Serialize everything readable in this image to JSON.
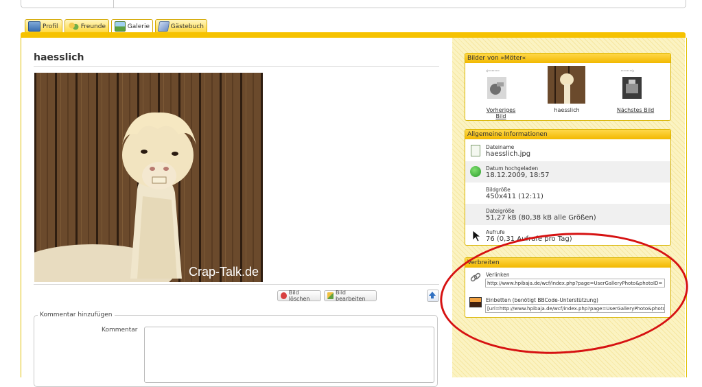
{
  "tabs": [
    {
      "label": "Profil",
      "icon": "profile-card-icon"
    },
    {
      "label": "Freunde",
      "icon": "friends-icon"
    },
    {
      "label": "Galerie",
      "icon": "gallery-icon"
    },
    {
      "label": "Gästebuch",
      "icon": "guestbook-icon"
    }
  ],
  "active_tab": "Galerie",
  "page_title": "haesslich",
  "photo_watermark": "Crap-Talk.de",
  "buttons": {
    "delete_label": "Bild löschen",
    "edit_label": "Bild bearbeiten"
  },
  "comment": {
    "legend": "Kommentar hinzufügen",
    "label": "Kommentar"
  },
  "images_panel": {
    "title": "Bilder von »Möter«",
    "prev_label": "Vorheriges Bild",
    "current_label": "haesslich",
    "next_label": "Nächstes Bild"
  },
  "info_panel": {
    "title": "Allgemeine Informationen",
    "rows": [
      {
        "label": "Dateiname",
        "value": "haesslich.jpg"
      },
      {
        "label": "Datum hochgeladen",
        "value": "18.12.2009, 18:57"
      },
      {
        "label": "Bildgröße",
        "value": "450x411 (12:11)"
      },
      {
        "label": "Dateigröße",
        "value": "51,27 kB (80,38 kB alle Größen)"
      },
      {
        "label": "Aufrufe",
        "value": "76 (0,31 Aufrufe pro Tag)"
      }
    ]
  },
  "share_panel": {
    "title": "Verbreiten",
    "link_label": "Verlinken",
    "link_value": "http://www.hpibaja.de/wcf/index.php?page=UserGalleryPhoto&photoID=",
    "embed_label": "Einbetten (benötigt BBCode-Unterstützung)",
    "embed_value": "[url=http://www.hpibaja.de/wcf/index.php?page=UserGalleryPhoto&photoID="
  },
  "colors": {
    "tab_gold": "#f6c200",
    "panel_header": "#f2b800",
    "annotation_red": "#d61212"
  }
}
